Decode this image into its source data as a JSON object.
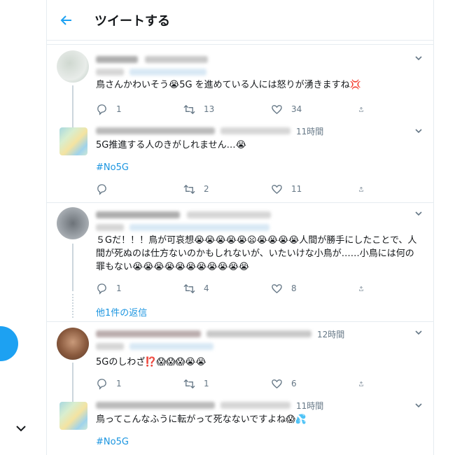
{
  "header": {
    "title": "ツイートする"
  },
  "tweets": [
    {
      "text": "鳥さんかわいそう😭5G を進めている人には怒りが湧きますね💢",
      "reply": "1",
      "retweet": "13",
      "like": "34"
    },
    {
      "time": "11時間",
      "text": "5G推進する人のきがしれません…😭",
      "hashtag": "#No5G",
      "reply": "",
      "retweet": "2",
      "like": "11"
    },
    {
      "text": "５Gだ！！！鳥が可哀想😭😭😭😭😭😦😭😭😭😭人間が勝手にしたことで、人間が死ぬのは仕方ないのかもしれないが、いたいけな小鳥が……小鳥には何の罪もない😭😭😭😭😭😭😭😭😭😭😭",
      "reply": "1",
      "retweet": "4",
      "like": "8",
      "show_more": "他1件の返信"
    },
    {
      "time": "12時間",
      "text": "5Gのしわざ⁉️😱😱😱😭😭",
      "reply": "1",
      "retweet": "1",
      "like": "6"
    },
    {
      "time": "11時間",
      "text": "鳥ってこんなふうに転がって死なないですよね😱💦",
      "hashtag": "#No5G"
    }
  ],
  "colors": {
    "accent": "#1da1f2",
    "link": "#1b95e0",
    "muted": "#657786",
    "border": "#e6ecf0"
  }
}
